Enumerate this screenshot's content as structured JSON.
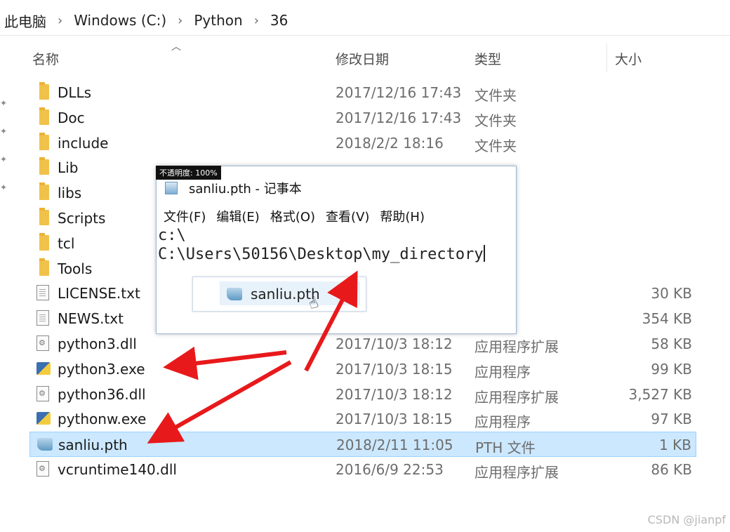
{
  "breadcrumb": [
    "此电脑",
    "Windows (C:)",
    "Python",
    "36"
  ],
  "columns": {
    "name": "名称",
    "date": "修改日期",
    "type": "类型",
    "size": "大小"
  },
  "files": [
    {
      "name": "DLLs",
      "date": "2017/12/16 17:43",
      "type": "文件夹",
      "size": "",
      "icon": "folder-icon"
    },
    {
      "name": "Doc",
      "date": "2017/12/16 17:43",
      "type": "文件夹",
      "size": "",
      "icon": "folder-icon"
    },
    {
      "name": "include",
      "date": "2018/2/2 18:16",
      "type": "文件夹",
      "size": "",
      "icon": "folder-icon"
    },
    {
      "name": "Lib",
      "date": "",
      "type": "",
      "size": "",
      "icon": "folder-icon"
    },
    {
      "name": "libs",
      "date": "",
      "type": "",
      "size": "",
      "icon": "folder-icon"
    },
    {
      "name": "Scripts",
      "date": "",
      "type": "",
      "size": "",
      "icon": "folder-icon"
    },
    {
      "name": "tcl",
      "date": "",
      "type": "",
      "size": "",
      "icon": "folder-icon"
    },
    {
      "name": "Tools",
      "date": "",
      "type": "",
      "size": "",
      "icon": "folder-icon"
    },
    {
      "name": "LICENSE.txt",
      "date": "",
      "type": "档",
      "size": "30 KB",
      "icon": "text-file-icon"
    },
    {
      "name": "NEWS.txt",
      "date": "",
      "type": "档",
      "size": "354 KB",
      "icon": "text-file-icon"
    },
    {
      "name": "python3.dll",
      "date": "2017/10/3 18:12",
      "type": "应用程序扩展",
      "size": "58 KB",
      "icon": "dll-file-icon"
    },
    {
      "name": "python3.exe",
      "date": "2017/10/3 18:15",
      "type": "应用程序",
      "size": "99 KB",
      "icon": "python-exe-icon"
    },
    {
      "name": "python36.dll",
      "date": "2017/10/3 18:12",
      "type": "应用程序扩展",
      "size": "3,527 KB",
      "icon": "dll-file-icon"
    },
    {
      "name": "pythonw.exe",
      "date": "2017/10/3 18:15",
      "type": "应用程序",
      "size": "97 KB",
      "icon": "python-exe-icon"
    },
    {
      "name": "sanliu.pth",
      "date": "2018/2/11 11:05",
      "type": "PTH 文件",
      "size": "1 KB",
      "icon": "pth-file-icon",
      "selected": true
    },
    {
      "name": "vcruntime140.dll",
      "date": "2016/6/9 22:53",
      "type": "应用程序扩展",
      "size": "86 KB",
      "icon": "dll-file-icon"
    }
  ],
  "notepad": {
    "opacity_badge": "不透明度: 100%",
    "title": "sanliu.pth - 记事本",
    "menu": [
      "文件(F)",
      "编辑(E)",
      "格式(O)",
      "查看(V)",
      "帮助(H)"
    ],
    "lines": [
      "c:\\",
      "C:\\Users\\50156\\Desktop\\my_directory"
    ]
  },
  "drag_ghost": {
    "label": "sanliu.pth"
  },
  "watermark": "CSDN @jianpf",
  "colors": {
    "selection": "#cce8ff",
    "arrow": "#e8191b",
    "folder": "#f0c24a"
  }
}
